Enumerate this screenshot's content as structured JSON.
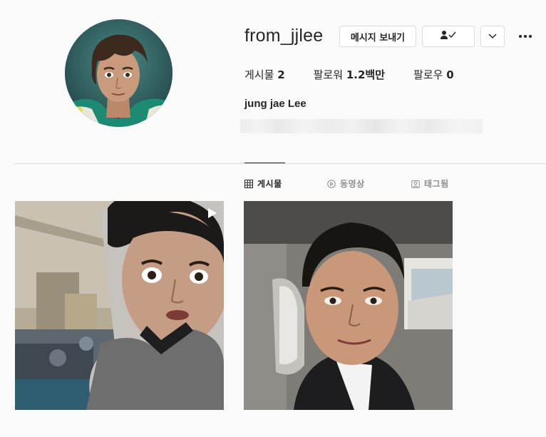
{
  "profile": {
    "username": "from_jjlee",
    "full_name": "jung jae Lee",
    "stats": {
      "posts_label": "게시물",
      "posts_count": "2",
      "followers_label": "팔로워",
      "followers_count": "1.2백만",
      "following_label": "팔로우",
      "following_count": "0"
    }
  },
  "actions": {
    "message_label": "메시지 보내기"
  },
  "tabs": [
    {
      "label": "게시물",
      "icon": "grid-icon",
      "active": true
    },
    {
      "label": "동영상",
      "icon": "play-circle-icon",
      "active": false
    },
    {
      "label": "태그됨",
      "icon": "tag-icon",
      "active": false
    }
  ],
  "colors": {
    "text": "#262626",
    "muted": "#8e8e8e",
    "border": "#dbdbdb",
    "background": "#fafafa"
  }
}
